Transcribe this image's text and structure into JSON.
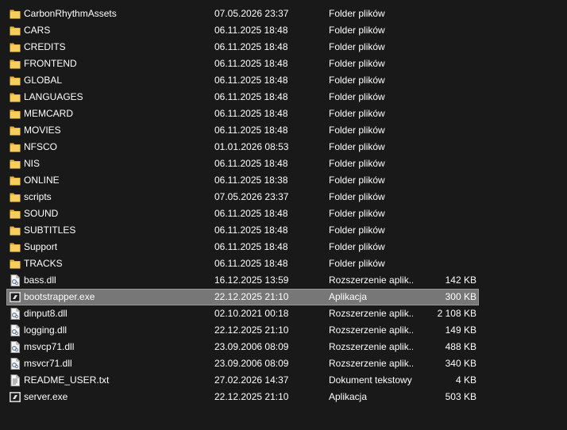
{
  "files": [
    {
      "name": "CarbonRhythmAssets",
      "date": "07.05.2026 23:37",
      "type": "Folder plików",
      "size": "",
      "icon": "folder-icon"
    },
    {
      "name": "CARS",
      "date": "06.11.2025 18:48",
      "type": "Folder plików",
      "size": "",
      "icon": "folder-icon"
    },
    {
      "name": "CREDITS",
      "date": "06.11.2025 18:48",
      "type": "Folder plików",
      "size": "",
      "icon": "folder-icon"
    },
    {
      "name": "FRONTEND",
      "date": "06.11.2025 18:48",
      "type": "Folder plików",
      "size": "",
      "icon": "folder-icon"
    },
    {
      "name": "GLOBAL",
      "date": "06.11.2025 18:48",
      "type": "Folder plików",
      "size": "",
      "icon": "folder-icon"
    },
    {
      "name": "LANGUAGES",
      "date": "06.11.2025 18:48",
      "type": "Folder plików",
      "size": "",
      "icon": "folder-icon"
    },
    {
      "name": "MEMCARD",
      "date": "06.11.2025 18:48",
      "type": "Folder plików",
      "size": "",
      "icon": "folder-icon"
    },
    {
      "name": "MOVIES",
      "date": "06.11.2025 18:48",
      "type": "Folder plików",
      "size": "",
      "icon": "folder-icon"
    },
    {
      "name": "NFSCO",
      "date": "01.01.2026 08:53",
      "type": "Folder plików",
      "size": "",
      "icon": "folder-icon"
    },
    {
      "name": "NIS",
      "date": "06.11.2025 18:48",
      "type": "Folder plików",
      "size": "",
      "icon": "folder-icon"
    },
    {
      "name": "ONLINE",
      "date": "06.11.2025 18:38",
      "type": "Folder plików",
      "size": "",
      "icon": "folder-icon"
    },
    {
      "name": "scripts",
      "date": "07.05.2026 23:37",
      "type": "Folder plików",
      "size": "",
      "icon": "folder-icon"
    },
    {
      "name": "SOUND",
      "date": "06.11.2025 18:48",
      "type": "Folder plików",
      "size": "",
      "icon": "folder-icon"
    },
    {
      "name": "SUBTITLES",
      "date": "06.11.2025 18:48",
      "type": "Folder plików",
      "size": "",
      "icon": "folder-icon"
    },
    {
      "name": "Support",
      "date": "06.11.2025 18:48",
      "type": "Folder plików",
      "size": "",
      "icon": "folder-icon"
    },
    {
      "name": "TRACKS",
      "date": "06.11.2025 18:48",
      "type": "Folder plików",
      "size": "",
      "icon": "folder-icon"
    },
    {
      "name": "bass.dll",
      "date": "16.12.2025 13:59",
      "type": "Rozszerzenie aplik...",
      "size": "142 KB",
      "icon": "dll-file-icon"
    },
    {
      "name": "bootstrapper.exe",
      "date": "22.12.2025 21:10",
      "type": "Aplikacja",
      "size": "300 KB",
      "icon": "exe-app-icon",
      "selected": true
    },
    {
      "name": "dinput8.dll",
      "date": "02.10.2021 00:18",
      "type": "Rozszerzenie aplik...",
      "size": "2 108 KB",
      "icon": "dll-file-icon"
    },
    {
      "name": "logging.dll",
      "date": "22.12.2025 21:10",
      "type": "Rozszerzenie aplik...",
      "size": "149 KB",
      "icon": "dll-file-icon"
    },
    {
      "name": "msvcp71.dll",
      "date": "23.09.2006 08:09",
      "type": "Rozszerzenie aplik...",
      "size": "488 KB",
      "icon": "dll-file-icon"
    },
    {
      "name": "msvcr71.dll",
      "date": "23.09.2006 08:09",
      "type": "Rozszerzenie aplik...",
      "size": "340 KB",
      "icon": "dll-file-icon"
    },
    {
      "name": "README_USER.txt",
      "date": "27.02.2026 14:37",
      "type": "Dokument tekstowy",
      "size": "4 KB",
      "icon": "text-file-icon"
    },
    {
      "name": "server.exe",
      "date": "22.12.2025 21:10",
      "type": "Aplikacja",
      "size": "503 KB",
      "icon": "exe-app-icon"
    }
  ],
  "colors": {
    "background": "#191919",
    "text": "#ffffff",
    "folder": "#f2c14e",
    "selection": "#777777"
  }
}
